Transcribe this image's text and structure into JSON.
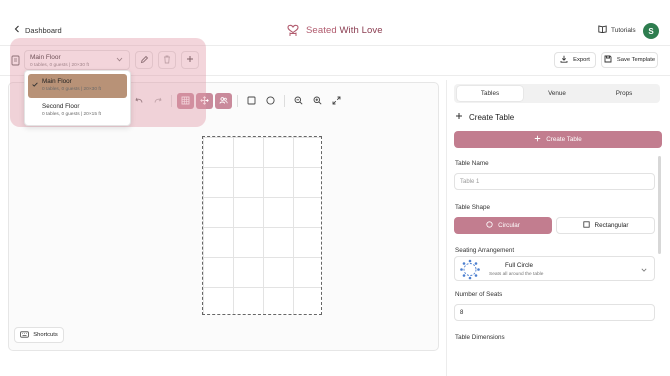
{
  "header": {
    "back_label": "Dashboard",
    "app_title_part1": "Seated",
    "app_title_part2": "With Love",
    "tutorials_label": "Tutorials",
    "avatar_initial": "S"
  },
  "floor_selector": {
    "selected_name": "Main Floor",
    "selected_info": "0 tables, 0 guests | 20×30 ft"
  },
  "floor_dropdown": {
    "items": [
      {
        "name": "Main Floor",
        "info": "0 tables, 0 guests | 20×30 ft",
        "selected": true
      },
      {
        "name": "Second Floor",
        "info": "0 tables, 0 guests | 20×15 ft",
        "selected": false
      }
    ]
  },
  "toolbar": {
    "export_label": "Export",
    "save_template_label": "Save Template"
  },
  "canvas": {
    "shortcuts_label": "Shortcuts"
  },
  "panel": {
    "tabs": [
      {
        "label": "Tables",
        "active": true
      },
      {
        "label": "Venue",
        "active": false
      },
      {
        "label": "Props",
        "active": false
      }
    ],
    "create_table_heading": "Create Table",
    "create_table_button": "Create Table",
    "table_name_label": "Table Name",
    "table_name_placeholder": "Table 1",
    "table_shape_label": "Table Shape",
    "shape_circular": "Circular",
    "shape_rectangular": "Rectangular",
    "seating_label": "Seating Arrangement",
    "seating_value": "Full Circle",
    "seating_desc": "Seats all around the table",
    "seats_label": "Number of Seats",
    "seats_value": "8",
    "dimensions_label": "Table Dimensions"
  },
  "colors": {
    "accent": "#c27d8f",
    "brand_text": "#b15b6e",
    "selected_item": "#b89277",
    "avatar": "#2e7d4f"
  }
}
